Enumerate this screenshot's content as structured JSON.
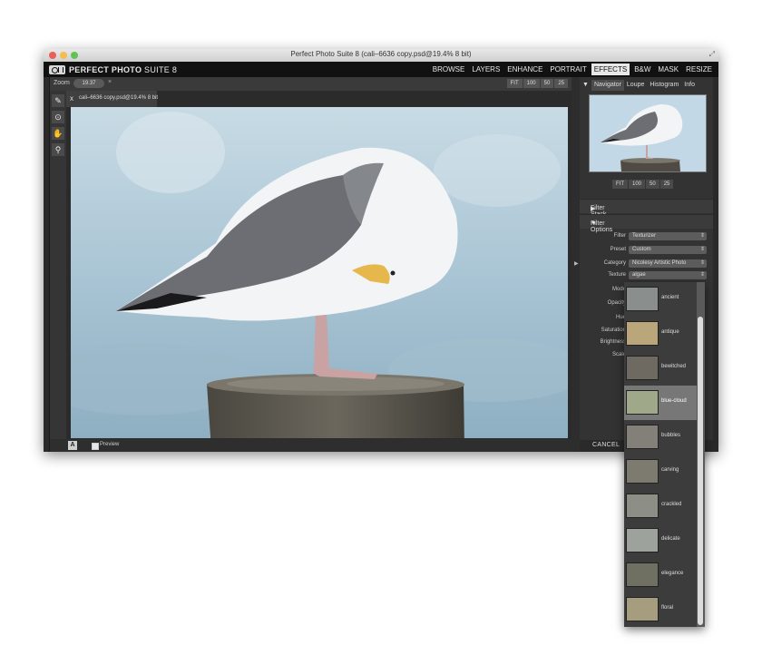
{
  "window": {
    "title": "Perfect Photo Suite 8 (cali–6636 copy.psd@19.4% 8 bit)"
  },
  "logo": {
    "brand": "PERFECT PHOTO",
    "suffix": " SUITE 8"
  },
  "nav": {
    "items": [
      "BROWSE",
      "LAYERS",
      "ENHANCE",
      "PORTRAIT",
      "EFFECTS",
      "B&W",
      "MASK",
      "RESIZE"
    ],
    "active": "EFFECTS"
  },
  "zoom": {
    "label": "Zoom",
    "value": "19.37",
    "presets": [
      "FIT",
      "100",
      "50",
      "25"
    ]
  },
  "document_tab": {
    "close": "x",
    "label": "cali–6636 copy.psd@19.4% 8 bit"
  },
  "status": {
    "a_label": "A",
    "preview_label": "Preview"
  },
  "right_panel": {
    "tabs": [
      "Navigator",
      "Loupe",
      "Histogram",
      "Info"
    ],
    "active_tab": "Navigator",
    "nav_presets": [
      "FIT",
      "100",
      "50",
      "25"
    ],
    "filter_stack": "Filter Stack",
    "filter_options": "Filter Options",
    "options": {
      "filter_label": "Filter",
      "filter_value": "Texturizer",
      "preset_label": "Preset",
      "preset_value": "Custom",
      "category_label": "Category",
      "category_value": "Nicolesy Artistic Photo",
      "texture_label": "Texture",
      "texture_value": "algae",
      "mode_label": "Mode",
      "opacity_label": "Opacity",
      "hue_label": "Hue",
      "saturation_label": "Saturation",
      "brightness_label": "Brightness",
      "scale_label": "Scale"
    },
    "cancel": "CANCEL"
  },
  "textures": {
    "items": [
      {
        "label": "ancient",
        "color": "#8a8f8e"
      },
      {
        "label": "antique",
        "color": "#b9a67a"
      },
      {
        "label": "bewitched",
        "color": "#6e6a62"
      },
      {
        "label": "blue-cloud",
        "color": "#9fa98a"
      },
      {
        "label": "bubbles",
        "color": "#828079"
      },
      {
        "label": "carving",
        "color": "#7d7a70"
      },
      {
        "label": "crackled",
        "color": "#8d8e86"
      },
      {
        "label": "delicate",
        "color": "#9ea29c"
      },
      {
        "label": "elegance",
        "color": "#6f6f62"
      },
      {
        "label": "floral",
        "color": "#a69c7e"
      }
    ],
    "selected": "blue-cloud"
  },
  "colors": {
    "active_nav_bg": "#e8e8e8",
    "traffic_red": "#ec5f57",
    "traffic_yellow": "#f4bd4f",
    "traffic_green": "#5fc454"
  }
}
